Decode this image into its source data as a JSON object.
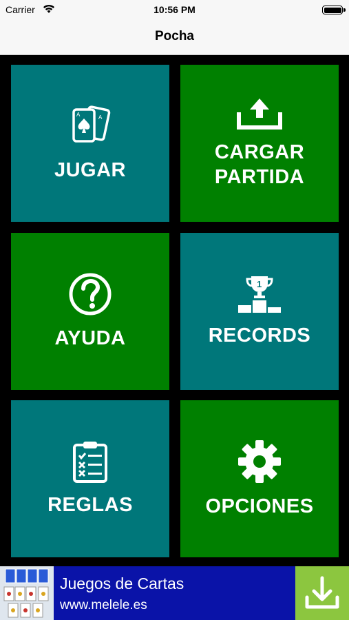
{
  "status_bar": {
    "carrier": "Carrier",
    "time": "10:56 PM"
  },
  "nav": {
    "title": "Pocha"
  },
  "tiles": {
    "jugar": {
      "label": "JUGAR",
      "icon": "playing-cards-icon",
      "color": "#00777a"
    },
    "cargar": {
      "label_line1": "CARGAR",
      "label_line2": "PARTIDA",
      "icon": "upload-icon",
      "color": "#008000"
    },
    "ayuda": {
      "label": "AYUDA",
      "icon": "question-circle-icon",
      "color": "#008000"
    },
    "records": {
      "label": "RECORDS",
      "icon": "trophy-podium-icon",
      "color": "#00777a"
    },
    "reglas": {
      "label": "REGLAS",
      "icon": "clipboard-checklist-icon",
      "color": "#00777a"
    },
    "opciones": {
      "label": "OPCIONES",
      "icon": "gear-icon",
      "color": "#008000"
    }
  },
  "ad": {
    "title": "Juegos de Cartas",
    "url": "www.melele.es",
    "background": "#0a13a8",
    "download_color": "#8cc63f",
    "icon": "download-icon"
  }
}
